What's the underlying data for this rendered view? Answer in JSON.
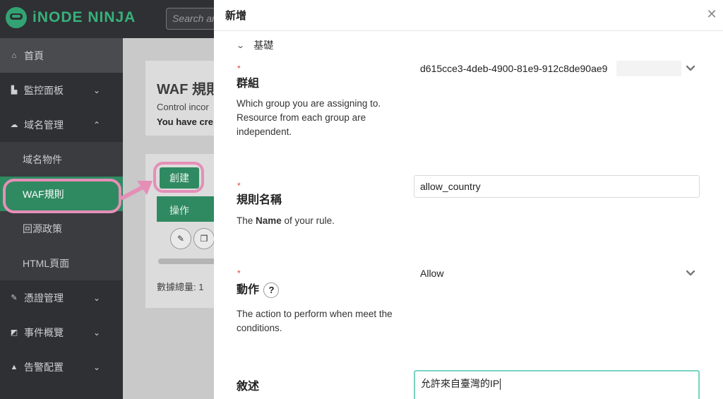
{
  "app": {
    "name": "iNODE NINJA"
  },
  "search": {
    "placeholder": "Search ar"
  },
  "sidebar": {
    "items": [
      {
        "label": "首頁"
      },
      {
        "label": "監控面板"
      },
      {
        "label": "域名管理"
      },
      {
        "label": "憑證管理"
      },
      {
        "label": "事件概覽"
      },
      {
        "label": "告警配置"
      }
    ],
    "sub_items": [
      {
        "label": "域名物件"
      },
      {
        "label": "WAF規則"
      },
      {
        "label": "回源政策"
      },
      {
        "label": "HTML頁面"
      }
    ]
  },
  "page": {
    "title": "WAF 規則",
    "description": "Control incor",
    "description_bold": "You have cre",
    "create_label": "創建",
    "table_header": "操作",
    "total_label": "數據總量: 1"
  },
  "drawer": {
    "title": "新增",
    "section_label": "基礎",
    "fields": {
      "group": {
        "label": "群組",
        "help": "Which group you are assigning to. Resource from each group are independent.",
        "value": "d615cce3-4deb-4900-81e9-912c8de90ae9"
      },
      "name": {
        "label": "規則名稱",
        "help_prefix": "The ",
        "help_bold": "Name",
        "help_suffix": " of your rule.",
        "value": "allow_country"
      },
      "action": {
        "label": "動作",
        "help": "The action to perform when meet the conditions.",
        "value": "Allow"
      },
      "description": {
        "label": "敘述",
        "value": "允許來自臺灣的IP"
      }
    }
  },
  "colors": {
    "brand": "#38b17c",
    "sidebar_bg": "#2e3033",
    "active_green": "#2f8a61",
    "highlight_pink": "#e58fb7",
    "required_red": "#e0453b",
    "focus_teal": "#78d3c1"
  }
}
